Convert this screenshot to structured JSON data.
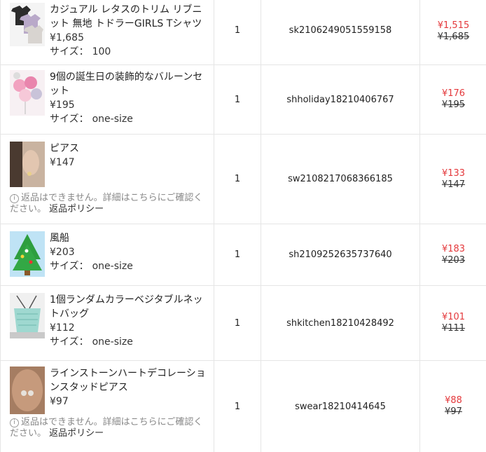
{
  "colors": {
    "sale_price": "#e4393c",
    "border": "#e5e5e5"
  },
  "rows": [
    {
      "name": "カジュアル レタスのトリム リブニット 無地 トドラーGIRLS Tシャツ",
      "price": "¥1,685",
      "size_label": "サイズ：",
      "size": "100",
      "qty": "1",
      "sku": "sk2106249051559158",
      "sale": "¥1,515",
      "original": "¥1,685",
      "thumb_icon": "shirts-thumbnail"
    },
    {
      "name": "9個の誕生日の装飾的なバルーンセット",
      "price": "¥195",
      "size_label": "サイズ：",
      "size": "one-size",
      "qty": "1",
      "sku": "shholiday18210406767",
      "sale": "¥176",
      "original": "¥195",
      "thumb_icon": "balloons-thumbnail"
    },
    {
      "name": "ピアス",
      "price": "¥147",
      "note": "返品はできません。詳細はこちらにご確認ください。",
      "note_link": "返品ポリシー",
      "qty": "1",
      "sku": "sw2108217068366185",
      "sale": "¥133",
      "original": "¥147",
      "thumb_icon": "earring-thumbnail"
    },
    {
      "name": "風船",
      "price": "¥203",
      "size_label": "サイズ：",
      "size": "one-size",
      "qty": "1",
      "sku": "sh2109252635737640",
      "sale": "¥183",
      "original": "¥203",
      "thumb_icon": "tree-balloon-thumbnail"
    },
    {
      "name": "1個ランダムカラーベジタブルネットバッグ",
      "price": "¥112",
      "size_label": "サイズ：",
      "size": "one-size",
      "qty": "1",
      "sku": "shkitchen18210428492",
      "sale": "¥101",
      "original": "¥111",
      "thumb_icon": "net-bag-thumbnail"
    },
    {
      "name": "ラインストーンハートデコレーションスタッドピアス",
      "price": "¥97",
      "note": "返品はできません。詳細はこちらにご確認ください。",
      "note_link": "返品ポリシー",
      "qty": "1",
      "sku": "swear18210414645",
      "sale": "¥88",
      "original": "¥97",
      "thumb_icon": "heart-stud-thumbnail"
    }
  ]
}
